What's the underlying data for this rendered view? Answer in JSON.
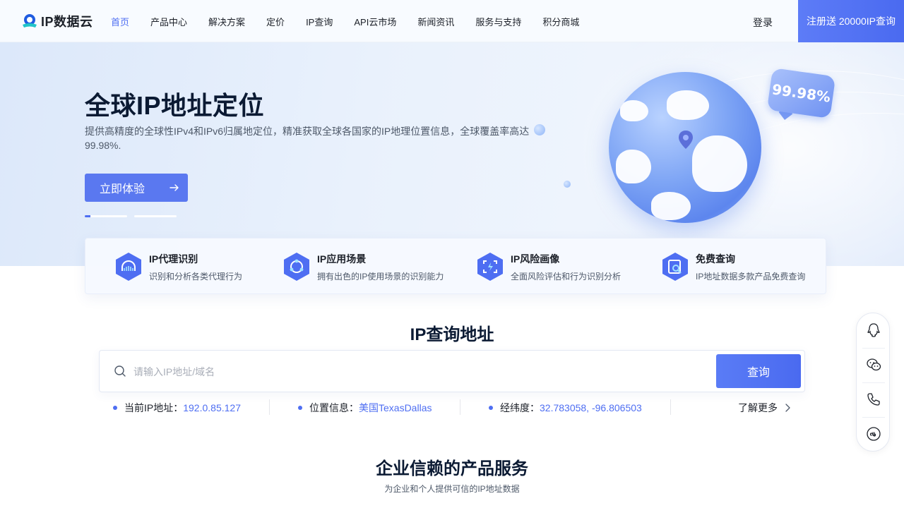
{
  "header": {
    "logo_text": "IP数据云",
    "nav": [
      "首页",
      "产品中心",
      "解决方案",
      "定价",
      "IP查询",
      "API云市场",
      "新闻资讯",
      "服务与支持",
      "积分商城"
    ],
    "active_index": 0,
    "login_label": "登录",
    "register_label": "注册送 20000IP查询"
  },
  "hero": {
    "title": "全球IP地址定位",
    "description": "提供高精度的全球性IPv4和IPv6归属地定位，精准获取全球各国家的IP地理位置信息，全球覆盖率高达99.98%.",
    "cta_label": "立即体验",
    "badge_text": "99.98%",
    "slides_count": 2,
    "active_slide": 0
  },
  "features": [
    {
      "title": "IP代理识别",
      "desc": "识别和分析各类代理行为",
      "icon": "proxy-icon"
    },
    {
      "title": "IP应用场景",
      "desc": "拥有出色的IP使用场景的识别能力",
      "icon": "scene-icon"
    },
    {
      "title": "IP风险画像",
      "desc": "全面风险评估和行为识别分析",
      "icon": "risk-icon"
    },
    {
      "title": "免费查询",
      "desc": "IP地址数据多款产品免费查询",
      "icon": "free-query-icon"
    }
  ],
  "ip_query": {
    "title": "IP查询地址",
    "placeholder": "请输入IP地址/域名",
    "button_label": "查询",
    "current_ip_label": "当前IP地址：",
    "current_ip": "192.0.85.127",
    "location_label": "位置信息：",
    "location": "美国TexasDallas",
    "coords_label": "经纬度：",
    "coords": "32.783058, -96.806503",
    "more_label": "了解更多"
  },
  "products": {
    "title": "企业信赖的产品服务",
    "subtitle": "为企业和个人提供可信的IP地址数据"
  },
  "float_bar": [
    "qq-icon",
    "wechat-icon",
    "phone-icon",
    "miniprogram-icon"
  ],
  "colors": {
    "accent": "#4e6ef2",
    "hero_bg": "#e9f1fc"
  }
}
